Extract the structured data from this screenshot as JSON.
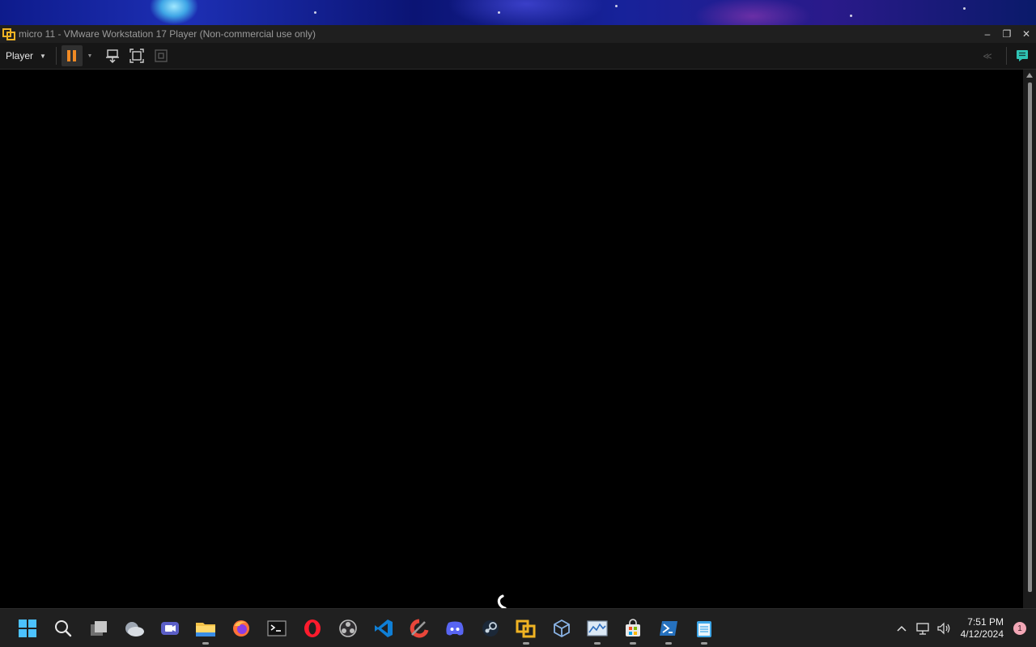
{
  "window": {
    "title": "micro 11 - VMware Workstation 17 Player (Non-commercial use only)",
    "controls": {
      "minimize": "–",
      "restore": "❐",
      "close": "✕"
    }
  },
  "toolbar": {
    "player_menu_label": "Player",
    "buttons": [
      "pause-button",
      "send-ctrl-alt-del-button",
      "full-screen-button",
      "unity-button"
    ],
    "accent_color": "#f08a24"
  },
  "vm_screen": {
    "state": "booting",
    "background": "#000000"
  },
  "taskbar": {
    "apps": [
      {
        "name": "start",
        "running": false
      },
      {
        "name": "search",
        "running": false
      },
      {
        "name": "task-view",
        "running": false
      },
      {
        "name": "widgets",
        "running": false
      },
      {
        "name": "meet",
        "running": false
      },
      {
        "name": "file-explorer",
        "running": true
      },
      {
        "name": "firefox",
        "running": false
      },
      {
        "name": "terminal",
        "running": false
      },
      {
        "name": "opera",
        "running": false
      },
      {
        "name": "obs",
        "running": false
      },
      {
        "name": "vscode",
        "running": false
      },
      {
        "name": "ccleaner",
        "running": false
      },
      {
        "name": "discord",
        "running": false
      },
      {
        "name": "steam",
        "running": false
      },
      {
        "name": "vmware",
        "running": true
      },
      {
        "name": "virtualbox",
        "running": false
      },
      {
        "name": "resource-monitor",
        "running": true
      },
      {
        "name": "microsoft-store",
        "running": true
      },
      {
        "name": "powershell",
        "running": true
      },
      {
        "name": "notepad",
        "running": true
      }
    ],
    "clock": {
      "time": "7:51 PM",
      "date": "4/12/2024"
    },
    "notification_count": "1"
  }
}
